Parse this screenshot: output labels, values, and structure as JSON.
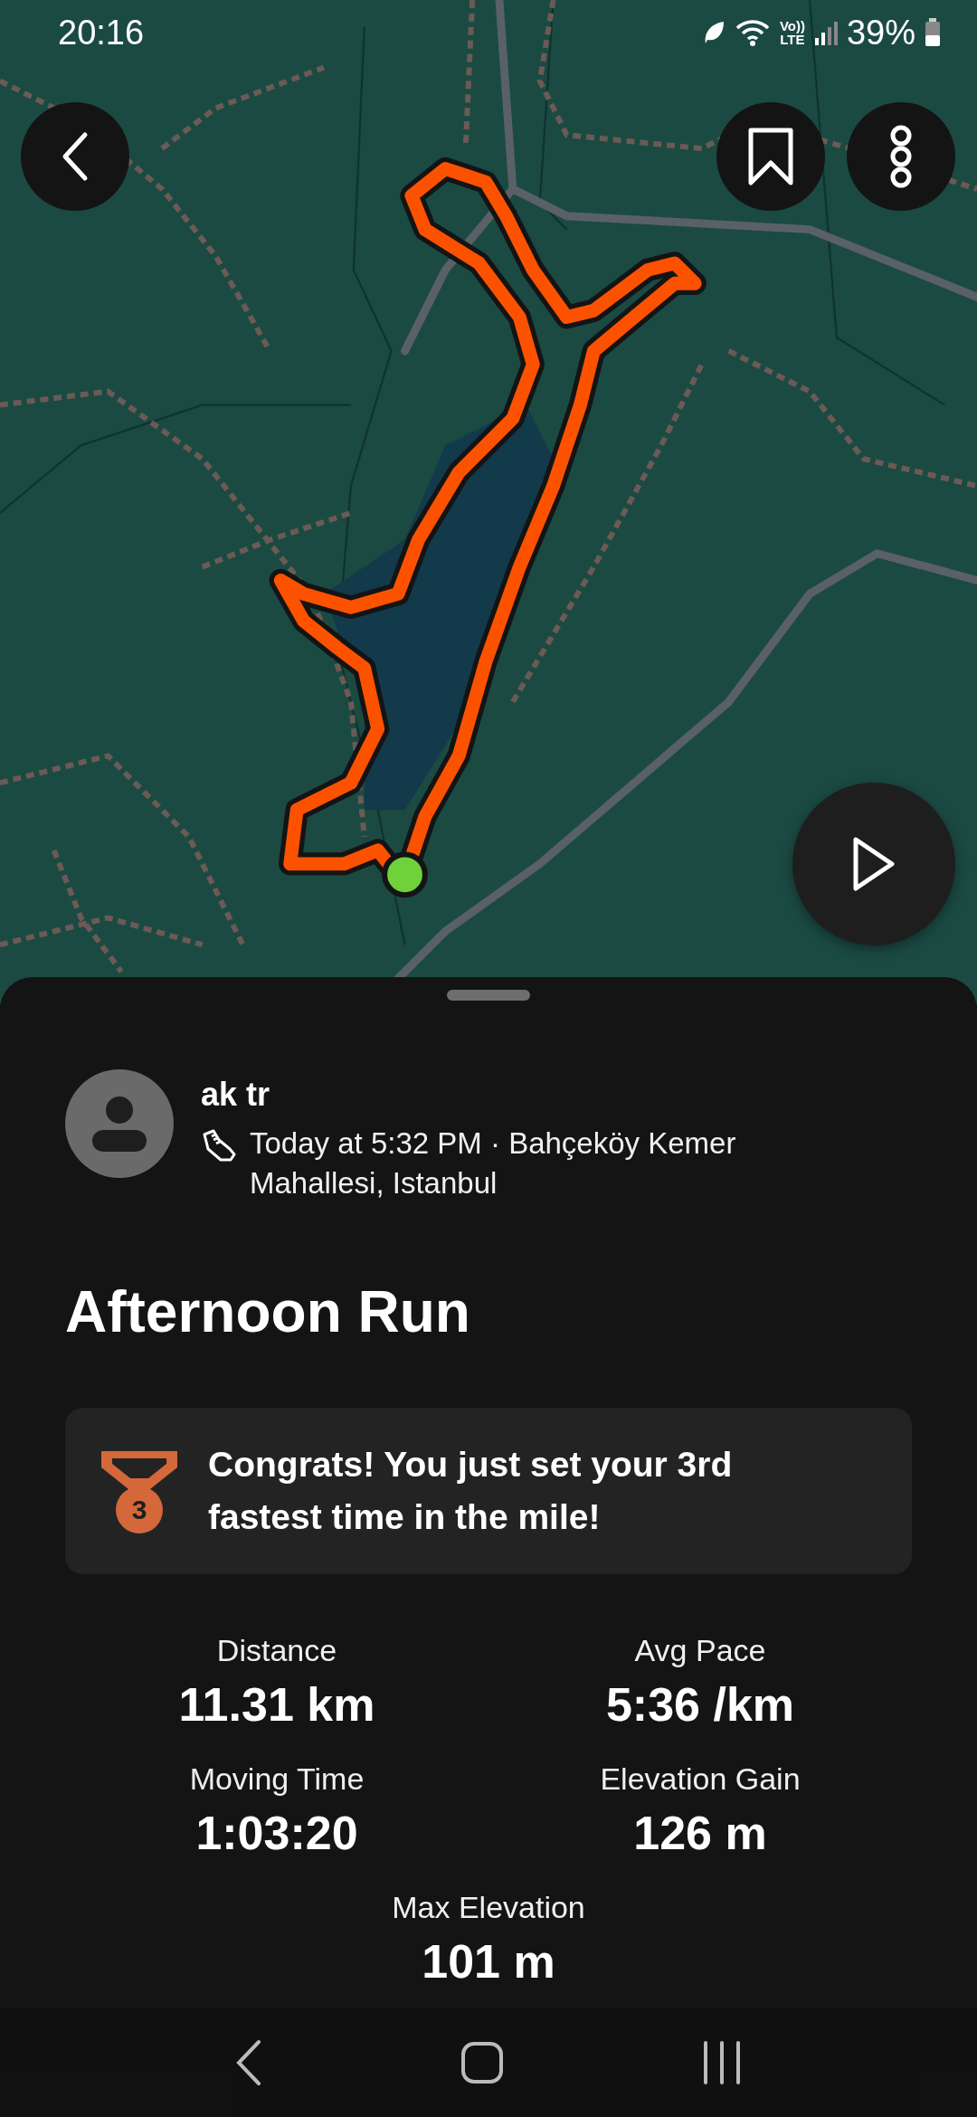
{
  "status_bar": {
    "time": "20:16",
    "network_top": "Vo))",
    "network_bottom": "LTE",
    "battery": "39%"
  },
  "sheet": {
    "athlete": {
      "name": "ak tr",
      "meta": "Today at 5:32 PM · Bahçeköy Kemer Mahallesi, Istanbul"
    },
    "title": "Afternoon Run",
    "achievement": {
      "rank": "3",
      "message": "Congrats! You just set your 3rd fastest time in the mile!"
    },
    "stats": [
      {
        "label": "Distance",
        "value": "11.31 km"
      },
      {
        "label": "Avg Pace",
        "value": "5:36 /km"
      },
      {
        "label": "Moving Time",
        "value": "1:03:20"
      },
      {
        "label": "Elevation Gain",
        "value": "126 m"
      },
      {
        "label": "Max Elevation",
        "value": "101 m"
      }
    ]
  }
}
